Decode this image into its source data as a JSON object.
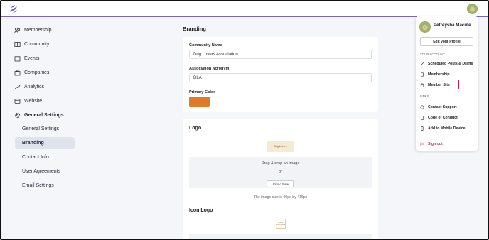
{
  "sidebar": {
    "items": [
      {
        "label": "Membership",
        "icon": "people-icon"
      },
      {
        "label": "Community",
        "icon": "book-icon"
      },
      {
        "label": "Events",
        "icon": "calendar-icon"
      },
      {
        "label": "Companies",
        "icon": "building-icon"
      },
      {
        "label": "Analytics",
        "icon": "chart-icon"
      },
      {
        "label": "Website",
        "icon": "globe-icon"
      },
      {
        "label": "General Settings",
        "icon": "gear-icon"
      }
    ],
    "sub_items": [
      "General Settings",
      "Branding",
      "Contact Info",
      "User Agreements",
      "Email Settings"
    ]
  },
  "main": {
    "branding_title": "Branding",
    "community_name_label": "Community Name",
    "community_name_value": "Dog Lovers Association",
    "acronym_label": "Association Acronym",
    "acronym_value": "DLA",
    "primary_color_label": "Primary Color",
    "primary_color": "#df7a2a",
    "logo_title": "Logo",
    "logo_thumb_text": "Dog Lovers",
    "drag_drop_text": "Drag & drop an image",
    "or_text": "or",
    "upload_button": "Upload New",
    "image_size_hint": "The image size is 90px by 416px",
    "icon_logo_title": "Icon Logo",
    "icon_thumb_text": "DOG LOVERS"
  },
  "account_menu": {
    "user_name": "Petreysha Macute",
    "edit_profile": "Edit your Profile",
    "your_account_heading": "YOUR ACCOUNT",
    "account_items": [
      {
        "label": "Scheduled Posts & Drafts",
        "icon": "pencil-icon"
      },
      {
        "label": "Membership",
        "icon": "id-card-icon"
      },
      {
        "label": "Member Site",
        "icon": "lock-icon"
      }
    ],
    "links_heading": "LINKS",
    "link_items": [
      {
        "label": "Contact Support",
        "icon": "support-icon"
      },
      {
        "label": "Code of Conduct",
        "icon": "document-icon"
      },
      {
        "label": "Add to Mobile Device",
        "icon": "mobile-icon"
      }
    ],
    "sign_out": "Sign out"
  },
  "colors": {
    "accent": "#7b63c9",
    "highlight": "#c2185b",
    "sign_out": "#c23a3a"
  }
}
